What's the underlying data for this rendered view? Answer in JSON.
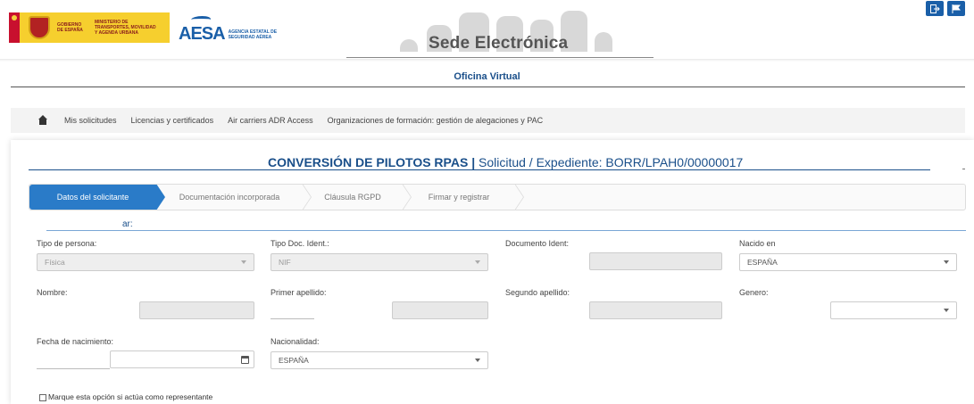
{
  "header": {
    "gov_text": "GOBIERNO DE ESPAÑA",
    "ministry_text": "MINISTERIO DE TRANSPORTES, MOVILIDAD Y AGENDA URBANA",
    "aesa_logo": "AESA",
    "aesa_sub": "AGENCIA ESTATAL DE SEGURIDAD AÉREA",
    "site_title": "Sede Electrónica",
    "logout_icon": "logout-icon",
    "flag_icon": "flag-icon"
  },
  "oficina_title": "Oficina Virtual",
  "nav": {
    "home_icon": "home-icon",
    "links": [
      "Mis solicitudes",
      "Licencias y certificados",
      "Air carriers ADR Access",
      "Organizaciones de formación: gestión de alegaciones y PAC"
    ]
  },
  "form_header": {
    "title_bold": "CONVERSIÓN DE PILOTOS RPAS",
    "separator": "|",
    "title_rest": "Solicitud / Expediente: BORR/LPAH0/00000017"
  },
  "steps": [
    "Datos del solicitante",
    "Documentación incorporada",
    "Cláusula RGPD",
    "Firmar y registrar"
  ],
  "active_step": 0,
  "section_label": "ar:",
  "fields": {
    "tipo_persona": {
      "label": "Tipo de persona:",
      "value": "Física"
    },
    "tipo_doc": {
      "label": "Tipo Doc. Ident.:",
      "value": "NIF"
    },
    "documento": {
      "label": "Documento Ident:",
      "value": ""
    },
    "nacido_en": {
      "label": "Nacido en",
      "value": "ESPAÑA"
    },
    "nombre": {
      "label": "Nombre:",
      "value": ""
    },
    "primer_apellido": {
      "label": "Primer apellido:",
      "value": ""
    },
    "segundo_apellido": {
      "label": "Segundo apellido:",
      "value": ""
    },
    "genero": {
      "label": "Genero:",
      "value": ""
    },
    "fecha_nac": {
      "label": "Fecha de nacimiento:",
      "value": ""
    },
    "nacionalidad": {
      "label": "Nacionalidad:",
      "value": "ESPAÑA"
    }
  },
  "checkbox_representante": "Marque esta opción si actúa como representante",
  "colors": {
    "primary": "#1a4f8a",
    "active_step": "#2a7bc8",
    "top_button": "#1a5fa8"
  }
}
